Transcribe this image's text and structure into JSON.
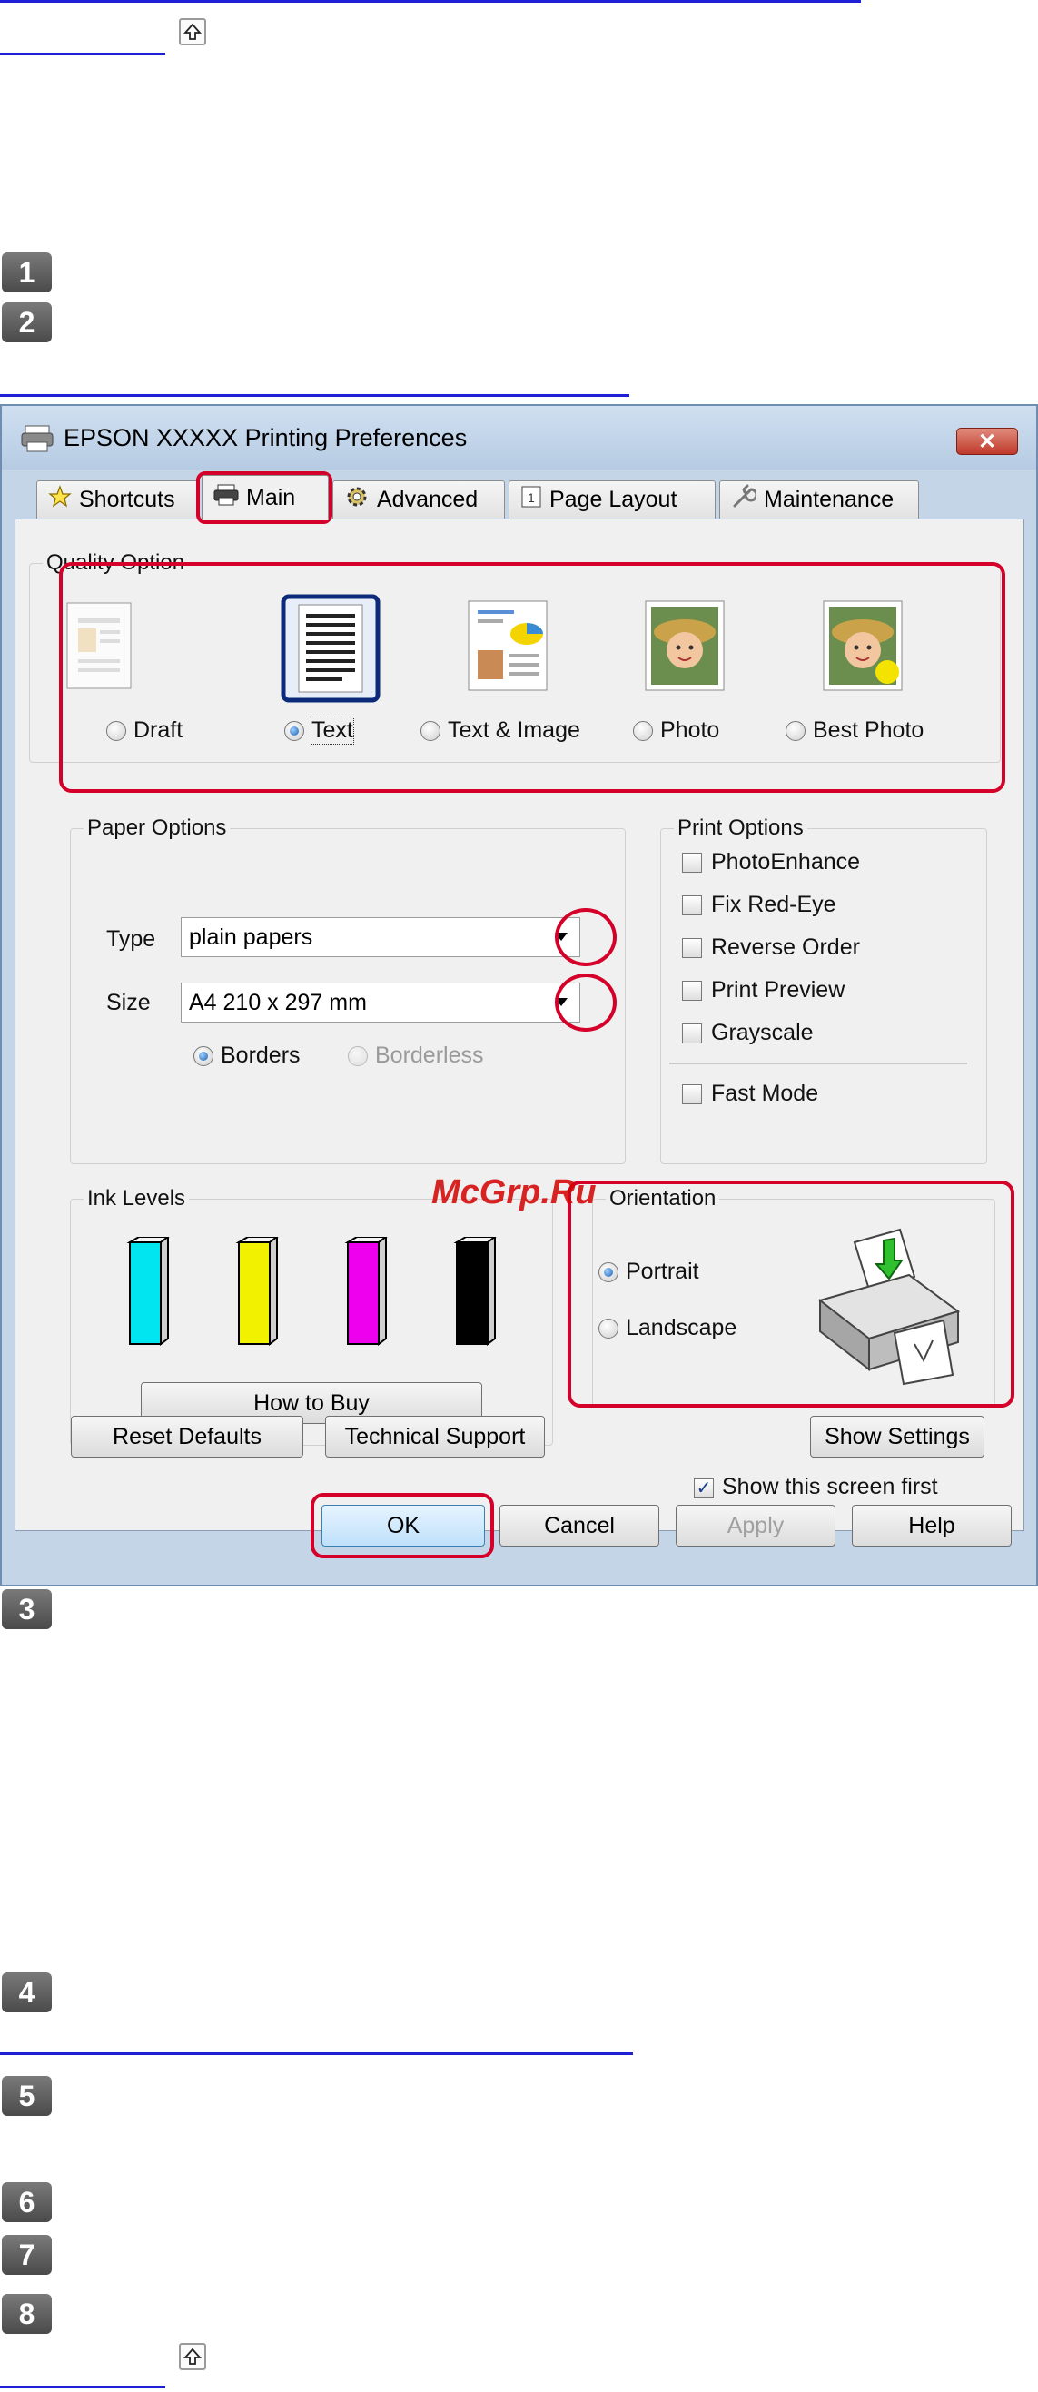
{
  "nav": {
    "up_icon": "up-arrow-icon"
  },
  "steps": [
    "1",
    "2",
    "3",
    "4",
    "5",
    "6",
    "7",
    "8"
  ],
  "dialog": {
    "title": "EPSON XXXXX   Printing Preferences",
    "close_label": "✕",
    "tabs": [
      {
        "label": "Shortcuts",
        "icon": "star-icon"
      },
      {
        "label": "Main",
        "icon": "printer-icon"
      },
      {
        "label": "Advanced",
        "icon": "gear-icon"
      },
      {
        "label": "Page Layout",
        "icon": "page-icon"
      },
      {
        "label": "Maintenance",
        "icon": "wrench-icon"
      }
    ],
    "quality": {
      "label": "Quality Option",
      "options": [
        "Draft",
        "Text",
        "Text & Image",
        "Photo",
        "Best Photo"
      ],
      "selected": "Text"
    },
    "paper": {
      "label": "Paper Options",
      "type_label": "Type",
      "type_value": "plain papers",
      "size_label": "Size",
      "size_value": "A4 210 x 297 mm",
      "borders": "Borders",
      "borderless": "Borderless"
    },
    "print_options": {
      "label": "Print Options",
      "items": [
        "PhotoEnhance",
        "Fix Red-Eye",
        "Reverse Order",
        "Print Preview",
        "Grayscale"
      ],
      "fast_mode": "Fast Mode"
    },
    "ink": {
      "label": "Ink Levels",
      "colors": [
        "#00e5f0",
        "#f2f200",
        "#ee00ee",
        "#000000"
      ],
      "how_to_buy": "How to Buy"
    },
    "orientation": {
      "label": "Orientation",
      "portrait": "Portrait",
      "landscape": "Landscape"
    },
    "show_first": "Show this screen first",
    "buttons": {
      "reset": "Reset Defaults",
      "support": "Technical Support",
      "show_settings": "Show Settings",
      "ok": "OK",
      "cancel": "Cancel",
      "apply": "Apply",
      "help": "Help"
    }
  },
  "watermark": "McGrp.Ru",
  "colors": {
    "accent_red": "#d4002a",
    "link_blue": "#1f1fd6"
  }
}
